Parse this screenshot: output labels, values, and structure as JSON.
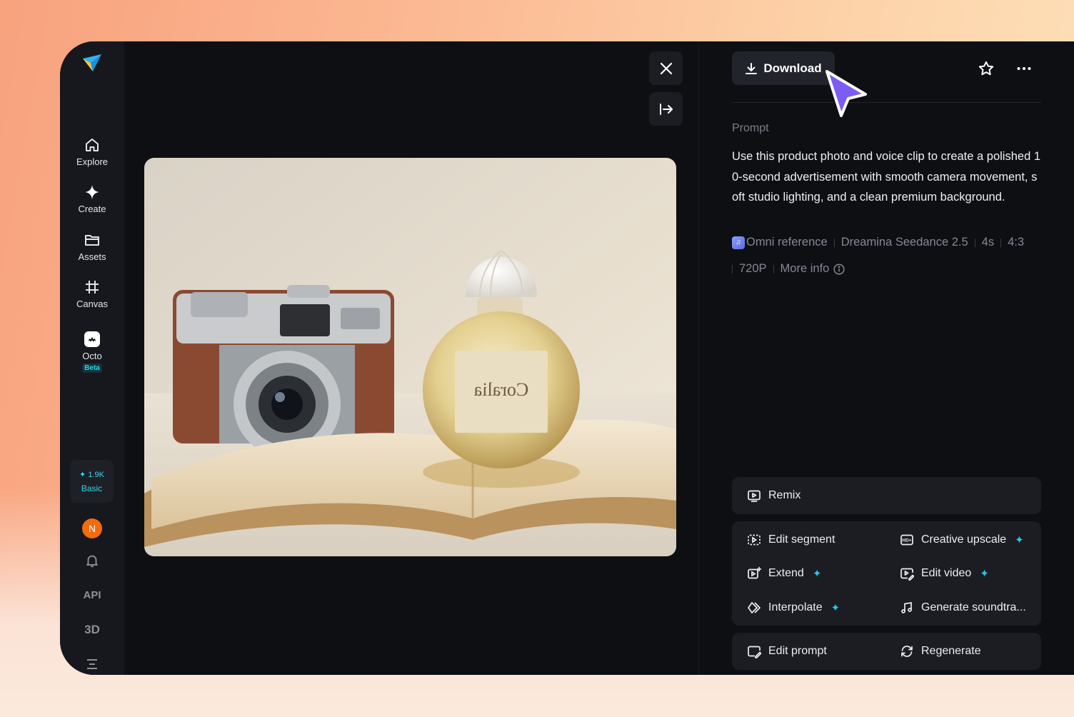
{
  "sidebar": {
    "items": [
      {
        "label": "Explore",
        "icon": "home-icon"
      },
      {
        "label": "Create",
        "icon": "sparkle-icon"
      },
      {
        "label": "Assets",
        "icon": "folder-icon"
      },
      {
        "label": "Canvas",
        "icon": "canvas-icon"
      },
      {
        "label": "Octo",
        "icon": "octo-icon",
        "badge": "Beta"
      }
    ],
    "credits": {
      "amount": "1.9K",
      "plan": "Basic"
    },
    "avatar_initial": "N",
    "api_label": "API",
    "threed_label": "3D"
  },
  "panel": {
    "download_label": "Download",
    "prompt_label": "Prompt",
    "prompt_text": "Use this product photo and voice clip to create a polished 10-second advertisement with smooth camera movement, soft studio lighting, and a clean premium background.",
    "meta": {
      "reference": "Omni reference",
      "model": "Dreamina Seedance 2.5",
      "duration": "4s",
      "ratio": "4:3",
      "resolution": "720P",
      "more_info": "More info"
    },
    "actions": {
      "remix": "Remix",
      "edit_segment": "Edit segment",
      "creative_upscale": "Creative upscale",
      "extend": "Extend",
      "edit_video": "Edit video",
      "interpolate": "Interpolate",
      "generate_soundtrack": "Generate soundtra...",
      "edit_prompt": "Edit prompt",
      "regenerate": "Regenerate"
    }
  },
  "photo": {
    "label_text": "Coralia"
  },
  "colors": {
    "accent": "#20c9ef",
    "cursor": "#7c5cf5",
    "avatar": "#f26b0f"
  }
}
